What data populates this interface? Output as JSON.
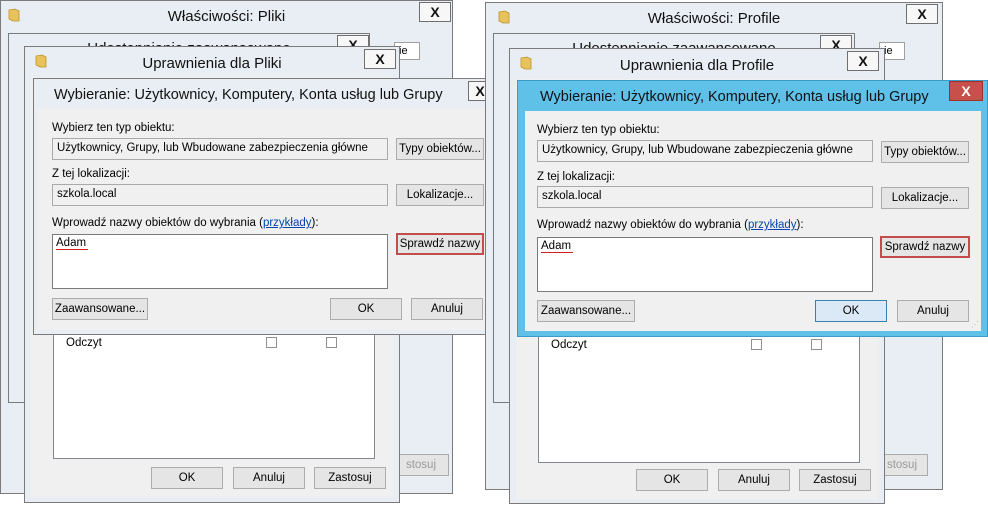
{
  "colors": {
    "active_frame": "#5fc0e8",
    "close_red": "#c7504a",
    "highlight_border": "#c34d4d",
    "link": "#0645ad"
  },
  "left": {
    "props_title": "Właściwości: Pliki",
    "adv_title": "Udostępnianie zaawansowane",
    "perm_title": "Uprawnienia dla Pliki",
    "select_title": "Wybieranie: Użytkownicy, Komputery, Konta usług lub Grupy",
    "tab_partial": "ie",
    "partial_button": "stosuj",
    "read_label": "Odczyt",
    "perm_buttons": {
      "ok": "OK",
      "cancel": "Anuluj",
      "apply": "Zastosuj"
    }
  },
  "right": {
    "props_title": "Właściwości: Profile",
    "adv_title": "Udostępnianie zaawansowane",
    "perm_title": "Uprawnienia dla Profile",
    "select_title": "Wybieranie: Użytkownicy, Komputery, Konta usług lub Grupy",
    "tab_partial": "ie",
    "partial_button": "stosuj",
    "read_label": "Odczyt",
    "perm_buttons": {
      "ok": "OK",
      "cancel": "Anuluj",
      "apply": "Zastosuj"
    }
  },
  "dialog": {
    "object_type_label": "Wybierz ten typ obiektu:",
    "object_type_value": "Użytkownicy, Grupy, lub Wbudowane zabezpieczenia główne",
    "object_types_button": "Typy obiektów...",
    "location_label": "Z tej lokalizacji:",
    "location_value": "szkola.local",
    "locations_button": "Lokalizacje...",
    "enter_names_label": "Wprowadź nazwy obiektów do wybrania (",
    "examples_link": "przykłady",
    "enter_names_suffix": "):",
    "names_value": "Adam",
    "check_names_button": "Sprawdź nazwy",
    "advanced_button": "Zaawansowane...",
    "ok_button": "OK",
    "cancel_button": "Anuluj"
  },
  "icons": {
    "close": "close-icon",
    "folder": "folder-icon",
    "close_glyph": "X"
  }
}
